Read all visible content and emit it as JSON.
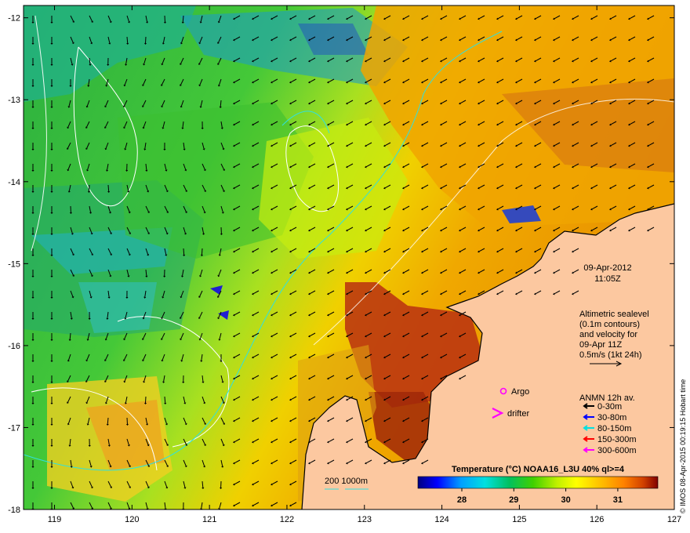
{
  "map": {
    "lon_ticks": [
      "119",
      "120",
      "121",
      "122",
      "123",
      "124",
      "125",
      "126",
      "127"
    ],
    "lat_ticks": [
      "-12",
      "-13",
      "-14",
      "-15",
      "-16",
      "-17",
      "-18"
    ],
    "datetime": {
      "date": "09-Apr-2012",
      "time": "11:05Z"
    },
    "altimetry_note": [
      "Altimetric sealevel",
      "(0.1m contours)",
      "and velocity for",
      "09-Apr 11Z",
      "0.5m/s (1kt 24h)"
    ],
    "markers": {
      "argo_label": "Argo",
      "drifter_label": "drifter"
    },
    "anmn_legend": {
      "title": "ANMN 12h av.",
      "entries": [
        {
          "label": "0-30m",
          "color": "#000000"
        },
        {
          "label": "30-80m",
          "color": "#0000ff"
        },
        {
          "label": "80-150m",
          "color": "#00e0e0"
        },
        {
          "label": "150-300m",
          "color": "#ff0000"
        },
        {
          "label": "300-600m",
          "color": "#ff00ff"
        }
      ]
    },
    "isobath_label": "200  1000m",
    "colorbar": {
      "title": "Temperature (°C) NOAA16_L3U 40% ql>=4",
      "ticks": [
        "28",
        "29",
        "30",
        "31"
      ]
    },
    "credit": "© IMOS 08-Apr-2015 00:19:15 Hobart time",
    "colors": {
      "land": "#fcc8a0",
      "water_warm": "#f0a000",
      "water_mid": "#30c030",
      "water_cool": "#10b0d0"
    }
  }
}
